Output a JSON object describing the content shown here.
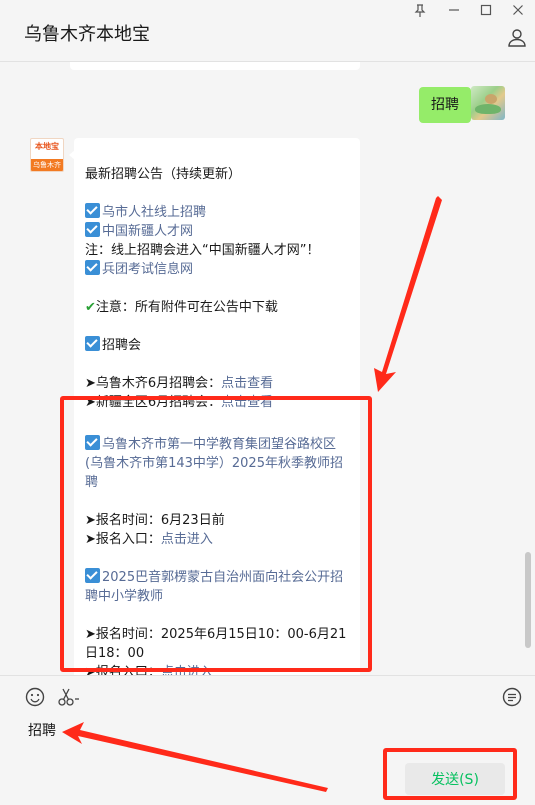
{
  "window": {
    "title": "乌鲁木齐本地宝",
    "controls": [
      "pin-icon",
      "minimize-icon",
      "maximize-icon",
      "close-icon"
    ]
  },
  "my_message": {
    "text": "招聘"
  },
  "subscription": {
    "avatar_top": "本地宝",
    "avatar_bar": "乌鲁木齐"
  },
  "article": {
    "heading": "最新招聘公告（持续更新）",
    "link_1": "乌市人社线上招聘",
    "link_2": "中国新疆人才网",
    "note": "注：线上招聘会进入“中国新疆人才网”！",
    "link_3": "兵团考试信息网",
    "attention": "注意：所有附件可在公告中下载",
    "fair_heading": "招聘会",
    "fair_1_prefix": "➤乌鲁木齐6月招聘会：",
    "fair_1_link": "点击查看",
    "fair_2_prefix": "➤新疆全区6月招聘会：",
    "fair_2_link": "点击查看",
    "job_1_title": "乌鲁木齐市第一中学教育集团望谷路校区(乌鲁木齐市第143中学）2025年秋季教师招聘",
    "job_1_time": "➤报名时间：6月23日前",
    "job_1_entry_prefix": "➤报名入口：",
    "job_1_entry_link": "点击进入",
    "job_2_title": "2025巴音郭楞蒙古自治州面向社会公开招聘中小学教师",
    "job_2_time": "➤报名时间：2025年6月15日10：00-6月21日18：00",
    "job_2_entry_prefix": "➤报名入口：",
    "job_2_entry_link": "点击进入"
  },
  "input": {
    "text": "招聘",
    "send_label": "发送(S)"
  },
  "colors": {
    "accent": "#07c160",
    "bubble_green": "#95ec69",
    "link": "#576b95",
    "highlight": "#ff2a1a"
  }
}
